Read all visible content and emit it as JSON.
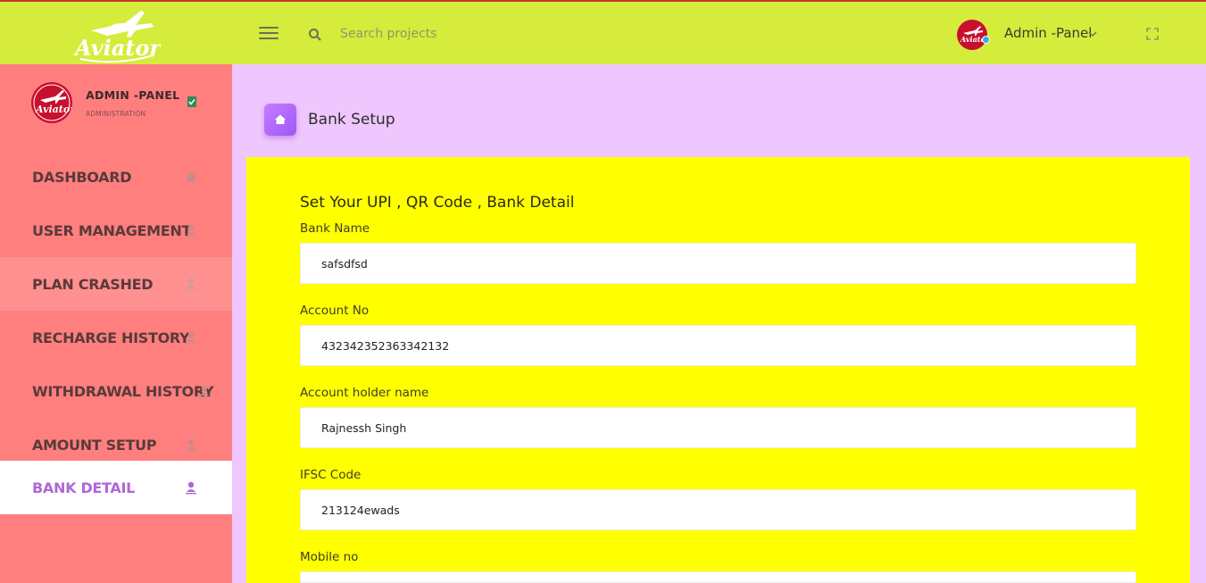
{
  "header": {
    "logo_text": "Aviator",
    "search_placeholder": "Search projects",
    "user_name": "Admin -Panel"
  },
  "sidebar": {
    "profile": {
      "name": "ADMIN -PANEL",
      "role": "ADMINISTRATION"
    },
    "items": [
      {
        "label": "DASHBOARD",
        "icon": "home-icon"
      },
      {
        "label": "USER MANAGEMENT",
        "icon": "user-icon"
      },
      {
        "label": "PLAN CRASHED",
        "icon": "user-icon"
      },
      {
        "label": "RECHARGE HISTORY",
        "icon": "user-icon"
      },
      {
        "label": "WITHDRAWAL HISTORY",
        "icon": "user-icon"
      },
      {
        "label": "AMOUNT SETUP",
        "icon": "user-icon"
      },
      {
        "label": "BANK DETAIL",
        "icon": "user-icon",
        "active": true
      }
    ]
  },
  "page": {
    "title": "Bank Setup"
  },
  "form": {
    "title": "Set Your UPI , QR Code , Bank Detail",
    "fields": [
      {
        "label": "Bank Name",
        "value": "safsdfsd"
      },
      {
        "label": "Account No",
        "value": "432342352363342132"
      },
      {
        "label": "Account holder name",
        "value": "Rajnessh Singh"
      },
      {
        "label": "IFSC Code",
        "value": "213124ewads"
      },
      {
        "label": "Mobile no",
        "value": ""
      }
    ]
  },
  "colors": {
    "topbar": "#d5ec3d",
    "sidebar": "#ff7f7f",
    "content_bg": "#efc6fe",
    "card": "#ffff00",
    "accent": "#b067d6"
  }
}
